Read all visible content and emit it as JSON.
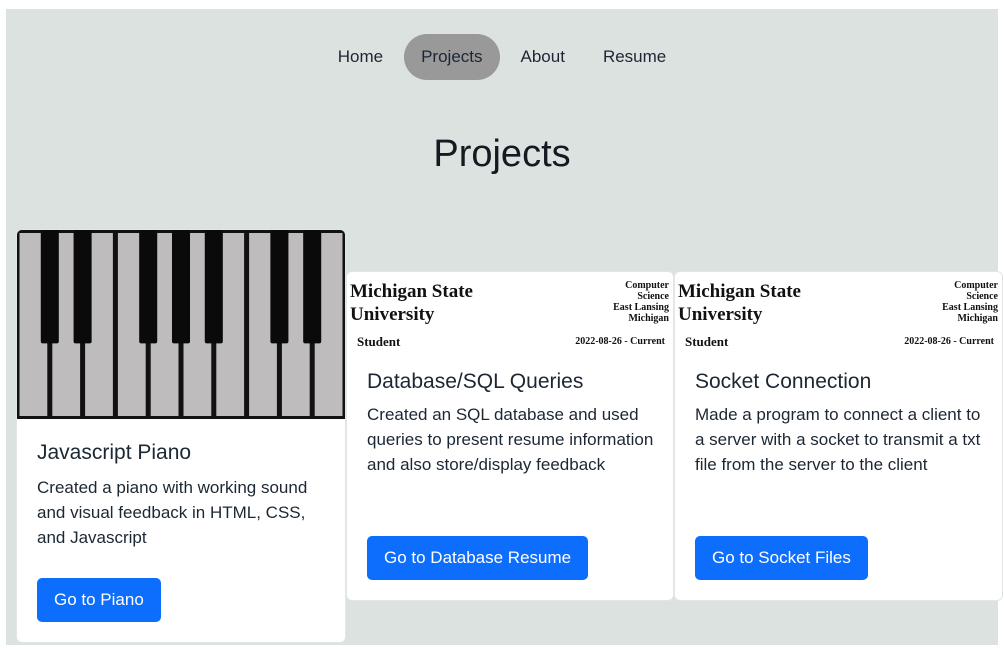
{
  "nav": {
    "items": [
      {
        "label": "Home",
        "active": false
      },
      {
        "label": "Projects",
        "active": true
      },
      {
        "label": "About",
        "active": false
      },
      {
        "label": "Resume",
        "active": false
      }
    ]
  },
  "page": {
    "title": "Projects"
  },
  "colors": {
    "background": "#dbe2df",
    "nav_active": "#999999",
    "button": "#0d6efd",
    "card": "#ffffff"
  },
  "resume_image": {
    "name_line1": "Michigan State",
    "name_line2": "University",
    "dept_lines": [
      "Computer",
      "Science",
      "East Lansing",
      "Michigan"
    ],
    "role": "Student",
    "dates": "2022-08-26 - Current"
  },
  "projects": [
    {
      "title": "Javascript Piano",
      "description": "Created a piano with working sound and visual feedback in HTML, CSS, and Javascript",
      "button": "Go to Piano",
      "image": "piano-keys"
    },
    {
      "title": "Database/SQL Queries",
      "description": "Created an SQL database and used queries to present resume information and also store/display feedback",
      "button": "Go to Database Resume",
      "image": "resume-header"
    },
    {
      "title": "Socket Connection",
      "description": "Made a program to connect a client to a server with a socket to transmit a txt file from the server to the client",
      "button": "Go to Socket Files",
      "image": "resume-header"
    }
  ]
}
